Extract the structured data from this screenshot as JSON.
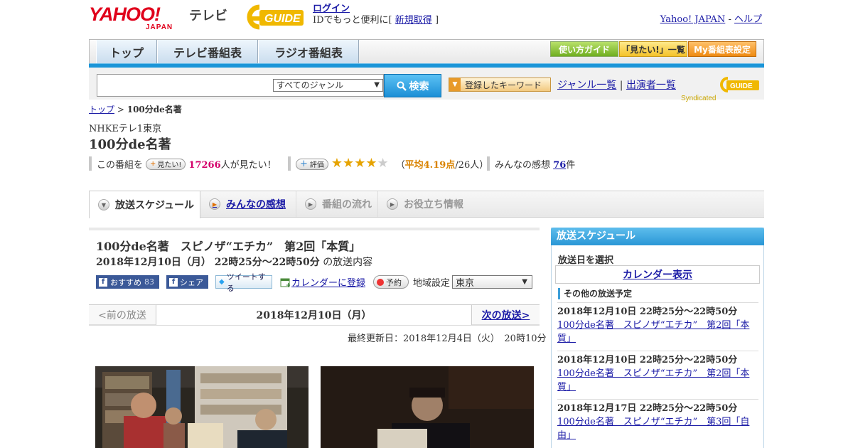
{
  "header": {
    "yahoo_text": "YAHOO!",
    "japan_text": "JAPAN",
    "tv_label": "テレビ",
    "gguide_text": "G GUIDE",
    "login": "ログイン",
    "login_prompt": "IDでもっと便利に[",
    "register": "新規取得",
    "login_prompt_end": "]",
    "yahoo_japan": "Yahoo! JAPAN",
    "sep": "-",
    "help": "ヘルプ"
  },
  "nav": {
    "tabs": [
      "トップ",
      "テレビ番組表",
      "ラジオ番組表"
    ],
    "right": [
      "使い方ガイド",
      "「見たい!」一覧",
      "My番組表設定"
    ]
  },
  "search": {
    "genre": "すべてのジャンル",
    "button": "検索",
    "keyword_button": "登録したキーワード",
    "genre_list": "ジャンル一覧",
    "divider": "|",
    "performer_list": "出演者一覧",
    "syndicated": "Syndicated"
  },
  "breadcrumb": {
    "top": "トップ",
    "sep": ">",
    "current": "100分de名著"
  },
  "program": {
    "channel": "NHKEテレ1東京",
    "title": "100分de名著",
    "want_prefix": "この番組を",
    "want_button": "見たい!",
    "want_count": "17266",
    "want_suffix": "人が見たい！",
    "rate_button": "評価",
    "rating": 4.19,
    "rating_open": "（",
    "rating_avg": "平均4.19点",
    "rating_count": "/26人）",
    "impressions_label": "みんなの感想",
    "impressions_count": "76",
    "impressions_suffix": "件"
  },
  "content_tabs": [
    "放送スケジュール",
    "みんなの感想",
    "番組の流れ",
    "お役立ち情報"
  ],
  "episode": {
    "title": "100分de名著　スピノザ“エチカ”　第2回「本質」",
    "airtime": "2018年12月10日（月） 22時25分～22時50分",
    "airtime_suffix": "の放送内容",
    "fb_recommend": "おすすめ",
    "fb_count": "83",
    "fb_share": "シェア",
    "tweet": "ツイートする",
    "calendar": "カレンダーに登録",
    "reserve": "予約",
    "region_label": "地域設定",
    "region": "東京"
  },
  "pager": {
    "prev": "<前の放送",
    "current": "2018年12月10日（月）",
    "next": "次の放送>"
  },
  "updated": "最終更新日：2018年12月4日（火）　20時10分",
  "sidebar": {
    "title": "放送スケジュール",
    "date_select": "放送日を選択",
    "calendar_button": "カレンダー表示",
    "other_label": "その他の放送予定",
    "items": [
      {
        "when": "2018年12月10日  22時25分～22時50分",
        "title": "100分de名著　スピノザ“エチカ”　第2回「本質」"
      },
      {
        "when": "2018年12月10日  22時25分～22時50分",
        "title": "100分de名著　スピノザ“エチカ”　第2回「本質」"
      },
      {
        "when": "2018年12月17日  22時25分～22時50分",
        "title": "100分de名著　スピノザ“エチカ”　第3回「自由」"
      }
    ]
  },
  "colors": {
    "brand_red": "#e0001b",
    "nav_blue": "#1b95d8",
    "link": "#1a1aa6",
    "star": "#e6a300",
    "want_pink": "#d4006a"
  }
}
